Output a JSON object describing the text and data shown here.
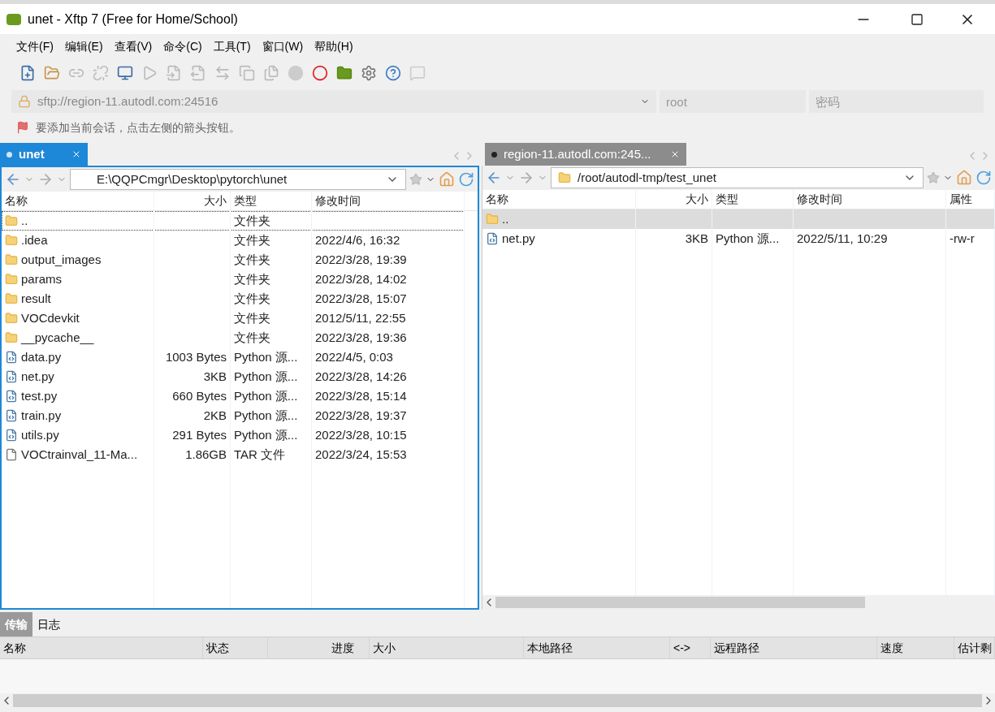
{
  "window": {
    "title": "unet - Xftp 7 (Free for Home/School)"
  },
  "menu": [
    "文件(F)",
    "编辑(E)",
    "查看(V)",
    "命令(C)",
    "工具(T)",
    "窗口(W)",
    "帮助(H)"
  ],
  "address": {
    "url": "sftp://region-11.autodl.com:24516",
    "user_placeholder": "root",
    "password_placeholder": "密码"
  },
  "hint": "要添加当前会话，点击左侧的箭头按钮。",
  "panels": [
    {
      "tab": {
        "label": "unet",
        "active": true
      },
      "path": "E:\\QQPCmgr\\Desktop\\pytorch\\unet",
      "columns": [
        "名称",
        "大小",
        "类型",
        "修改时间"
      ],
      "rows": [
        {
          "kind": "folder",
          "name": "..",
          "size": "",
          "type": "文件夹",
          "modified": "",
          "selected": false,
          "focused": true
        },
        {
          "kind": "folder",
          "name": ".idea",
          "type": "文件夹",
          "modified": "2022/4/6, 16:32",
          "selected": false,
          "focused": false
        },
        {
          "kind": "folder",
          "name": "output_images",
          "type": "文件夹",
          "modified": "2022/3/28, 19:39",
          "selected": false,
          "focused": false
        },
        {
          "kind": "folder",
          "name": "params",
          "type": "文件夹",
          "modified": "2022/3/28, 14:02",
          "selected": false,
          "focused": false
        },
        {
          "kind": "folder",
          "name": "result",
          "type": "文件夹",
          "modified": "2022/3/28, 15:07",
          "selected": false,
          "focused": false
        },
        {
          "kind": "folder",
          "name": "VOCdevkit",
          "type": "文件夹",
          "modified": "2012/5/11, 22:55",
          "selected": false,
          "focused": false
        },
        {
          "kind": "folder",
          "name": "__pycache__",
          "type": "文件夹",
          "modified": "2022/3/28, 19:36",
          "selected": false,
          "focused": false
        },
        {
          "kind": "python",
          "name": "data.py",
          "size": "1003 Bytes",
          "type": "Python 源...",
          "modified": "2022/4/5, 0:03",
          "selected": false,
          "focused": false
        },
        {
          "kind": "python",
          "name": "net.py",
          "size": "3KB",
          "type": "Python 源...",
          "modified": "2022/3/28, 14:26",
          "selected": false,
          "focused": false
        },
        {
          "kind": "python",
          "name": "test.py",
          "size": "660 Bytes",
          "type": "Python 源...",
          "modified": "2022/3/28, 15:14",
          "selected": false,
          "focused": false
        },
        {
          "kind": "python",
          "name": "train.py",
          "size": "2KB",
          "type": "Python 源...",
          "modified": "2022/3/28, 19:37",
          "selected": false,
          "focused": false
        },
        {
          "kind": "python",
          "name": "utils.py",
          "size": "291 Bytes",
          "type": "Python 源...",
          "modified": "2022/3/28, 10:15",
          "selected": false,
          "focused": false
        },
        {
          "kind": "file",
          "name": "VOCtrainval_11-Ma...",
          "size": "1.86GB",
          "type": "TAR 文件",
          "modified": "2022/3/24, 15:53",
          "selected": false,
          "focused": false
        }
      ]
    },
    {
      "tab": {
        "label": "region-11.autodl.com:245...",
        "active": false
      },
      "path": "/root/autodl-tmp/test_unet",
      "columns": [
        "名称",
        "大小",
        "类型",
        "修改时间",
        "属性"
      ],
      "rows": [
        {
          "kind": "folder",
          "name": "..",
          "type": "",
          "modified": "",
          "attributes": "",
          "selected": true,
          "focused": false
        },
        {
          "kind": "python",
          "name": "net.py",
          "size": "3KB",
          "type": "Python 源...",
          "modified": "2022/5/11, 10:29",
          "attributes": "-rw-r",
          "selected": false,
          "focused": false
        }
      ]
    }
  ],
  "bottom": {
    "tabs": [
      {
        "label": "传输",
        "selected": true
      },
      {
        "label": "日志",
        "selected": false
      }
    ],
    "columns": [
      "名称",
      "状态",
      "进度",
      "大小",
      "本地路径",
      "<->",
      "远程路径",
      "速度",
      "估计剩"
    ]
  }
}
